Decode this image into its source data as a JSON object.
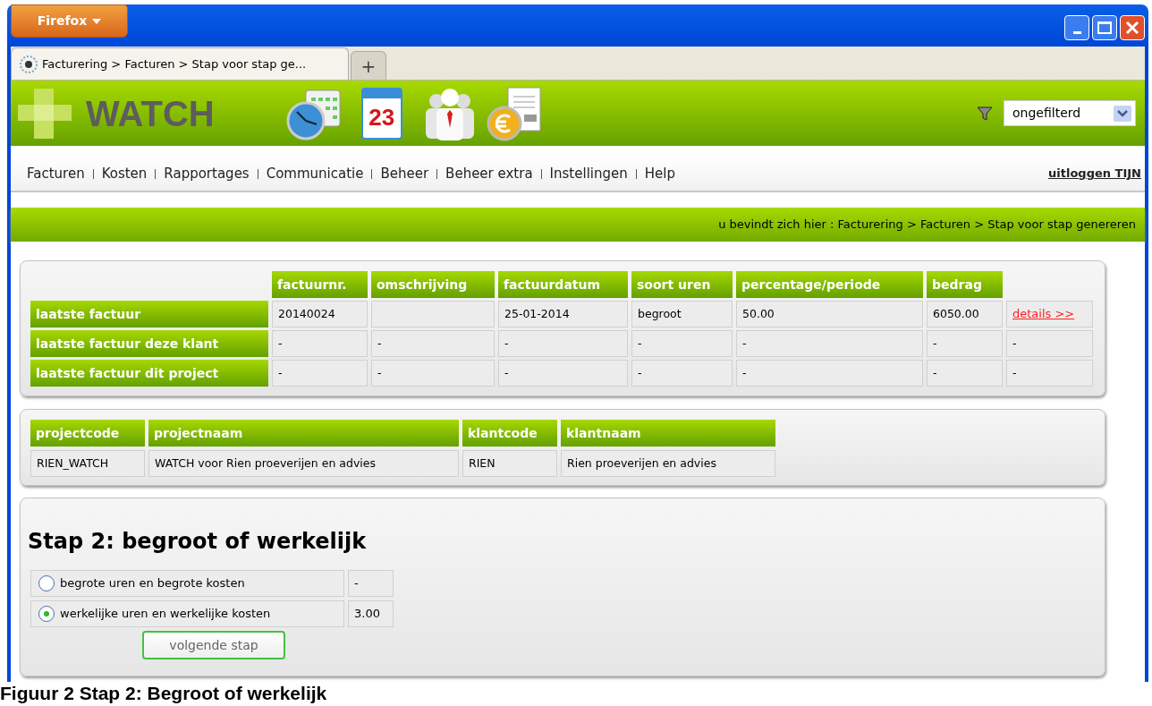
{
  "browser": {
    "menu_button": "Firefox",
    "tab_title": "Facturering > Facturen > Stap voor stap ge...",
    "new_tab": "+"
  },
  "app": {
    "logo": "WATCH",
    "calendar_day": "23",
    "filter": {
      "value": "ongefilterd"
    }
  },
  "nav": {
    "items": [
      "Facturen",
      "Kosten",
      "Rapportages",
      "Communicatie",
      "Beheer",
      "Beheer extra",
      "Instellingen",
      "Help"
    ],
    "logout": "uitloggen TIJN"
  },
  "breadcrumb": "u bevindt zich hier : Facturering > Facturen > Stap voor stap genereren",
  "invoice_table": {
    "columns": [
      "factuurnr.",
      "omschrijving",
      "factuurdatum",
      "soort uren",
      "percentage/periode",
      "bedrag"
    ],
    "rows": [
      {
        "label": "laatste factuur",
        "cells": [
          "20140024",
          "",
          "25-01-2014",
          "begroot",
          "50.00",
          "6050.00"
        ],
        "action": {
          "kind": "link",
          "text": "details >>"
        }
      },
      {
        "label": "laatste factuur deze klant",
        "cells": [
          "-",
          "-",
          "-",
          "-",
          "-",
          "-"
        ],
        "action": {
          "kind": "text",
          "text": "-"
        }
      },
      {
        "label": "laatste factuur dit project",
        "cells": [
          "-",
          "-",
          "-",
          "-",
          "-",
          "-"
        ],
        "action": {
          "kind": "text",
          "text": "-"
        }
      }
    ]
  },
  "project_table": {
    "columns": [
      "projectcode",
      "projectnaam",
      "klantcode",
      "klantnaam"
    ],
    "rows": [
      [
        "RIEN_WATCH",
        "WATCH voor Rien proeverijen en advies",
        "RIEN",
        "Rien proeverijen en advies"
      ]
    ]
  },
  "step": {
    "title": "Stap 2: begroot of werkelijk",
    "options": [
      {
        "label": "begrote uren en begrote kosten",
        "value": "-",
        "selected": false
      },
      {
        "label": "werkelijke uren en werkelijke kosten",
        "value": "3.00",
        "selected": true
      }
    ],
    "button": "volgende stap"
  },
  "caption": "Figuur 2 Stap 2: Begroot of werkelijk"
}
